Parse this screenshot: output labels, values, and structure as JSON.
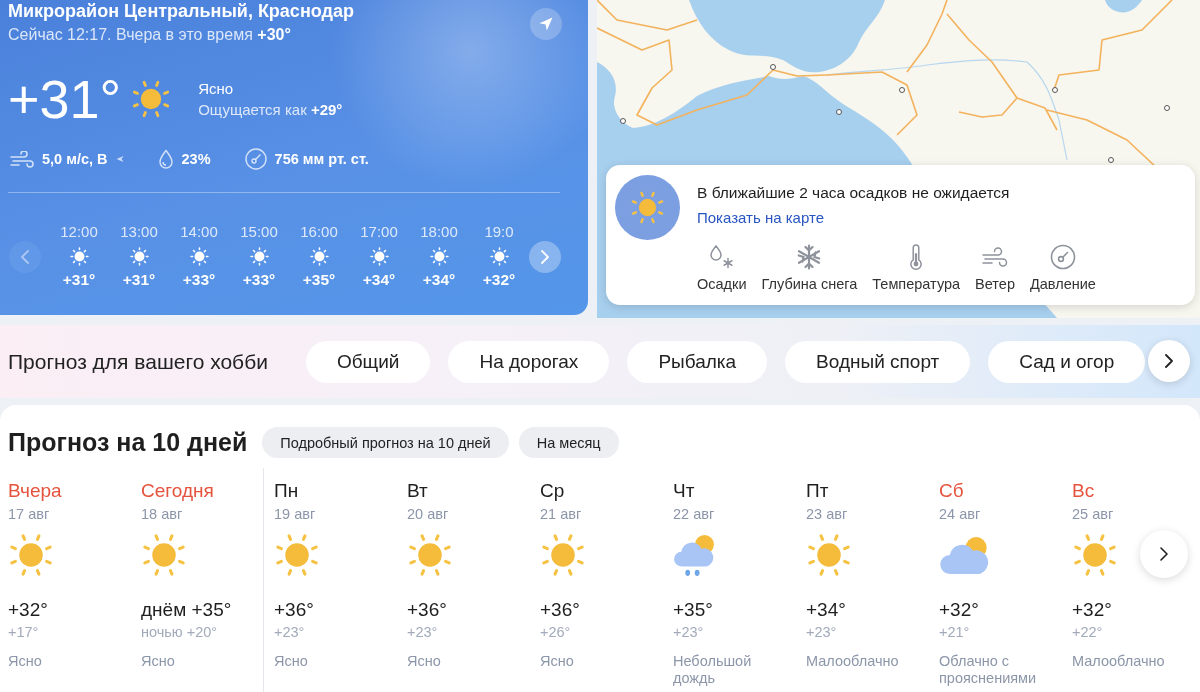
{
  "location": {
    "title": "Микрорайон Центральный, Краснодар",
    "subtitle": "Сейчас 12:17. Вчера в это время **+30°**"
  },
  "current": {
    "temperature": "+31°",
    "condition": "Ясно",
    "feels_like": "Ощущается как **+29°**"
  },
  "stats": [
    {
      "kind": "wind",
      "value": "5,0 м/с, В"
    },
    {
      "kind": "humidity",
      "value": "23%"
    },
    {
      "kind": "pressure",
      "value": "756 мм рт. ст."
    }
  ],
  "hourly": {
    "prev_disabled": true,
    "hours": [
      {
        "time": "12:00",
        "temp": "+31°"
      },
      {
        "time": "13:00",
        "temp": "+31°"
      },
      {
        "time": "14:00",
        "temp": "+33°"
      },
      {
        "time": "15:00",
        "temp": "+33°"
      },
      {
        "time": "16:00",
        "temp": "+35°"
      },
      {
        "time": "17:00",
        "temp": "+34°"
      },
      {
        "time": "18:00",
        "temp": "+34°"
      },
      {
        "time": "19:0",
        "temp": "+32°"
      }
    ]
  },
  "map_panel": {
    "message": "В ближайшие 2 часа осадков не ожидается",
    "link": "Показать на карте",
    "layers": [
      {
        "kind": "precipitation",
        "label": "Осадки"
      },
      {
        "kind": "snow_depth",
        "label": "Глубина снега"
      },
      {
        "kind": "temperature",
        "label": "Температура"
      },
      {
        "kind": "wind",
        "label": "Ветер"
      },
      {
        "kind": "pressure",
        "label": "Давление"
      }
    ]
  },
  "hobby": {
    "title": "Прогноз для вашего хобби",
    "options": [
      "Общий",
      "На дорогах",
      "Рыбалка",
      "Водный спорт",
      "Сад и огор"
    ]
  },
  "forecast": {
    "title": "Прогноз на 10 дней",
    "links": [
      "Подробный прогноз на 10 дней",
      "На месяц"
    ],
    "days": [
      {
        "name": "Вчера",
        "accent": true,
        "today": false,
        "date": "17 авг",
        "kind": "clear",
        "day_temp": "+32°",
        "night_temp": "+17°",
        "condition": "Ясно"
      },
      {
        "name": "Сегодня",
        "accent": true,
        "today": true,
        "date": "18 авг",
        "kind": "clear",
        "day_temp": "днём +35°",
        "night_temp": "ночью +20°",
        "condition": "Ясно"
      },
      {
        "name": "Пн",
        "accent": false,
        "today": false,
        "date": "19 авг",
        "kind": "clear",
        "day_temp": "+36°",
        "night_temp": "+23°",
        "condition": "Ясно"
      },
      {
        "name": "Вт",
        "accent": false,
        "today": false,
        "date": "20 авг",
        "kind": "clear",
        "day_temp": "+36°",
        "night_temp": "+23°",
        "condition": "Ясно"
      },
      {
        "name": "Ср",
        "accent": false,
        "today": false,
        "date": "21 авг",
        "kind": "clear",
        "day_temp": "+36°",
        "night_temp": "+26°",
        "condition": "Ясно"
      },
      {
        "name": "Чт",
        "accent": false,
        "today": false,
        "date": "22 авг",
        "kind": "light_rain",
        "day_temp": "+35°",
        "night_temp": "+23°",
        "condition": "Небольшой дождь"
      },
      {
        "name": "Пт",
        "accent": false,
        "today": false,
        "date": "23 авг",
        "kind": "clear",
        "day_temp": "+34°",
        "night_temp": "+23°",
        "condition": "Малооблачно"
      },
      {
        "name": "Сб",
        "accent": true,
        "today": false,
        "date": "24 авг",
        "kind": "partly_cloudy",
        "day_temp": "+32°",
        "night_temp": "+21°",
        "condition": "Облачно с прояснениями"
      },
      {
        "name": "Вс",
        "accent": true,
        "today": false,
        "date": "25 авг",
        "kind": "clear",
        "day_temp": "+32°",
        "night_temp": "+22°",
        "condition": "Малооблачно"
      }
    ]
  }
}
